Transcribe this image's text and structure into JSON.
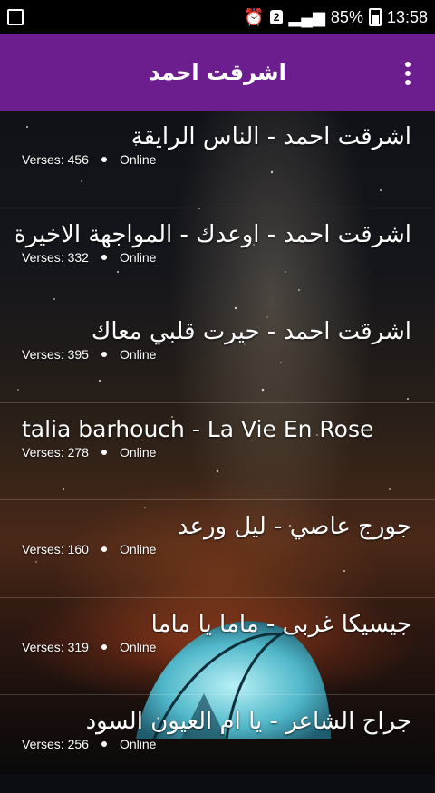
{
  "status_bar": {
    "badge": "2",
    "battery": "85%",
    "time": "13:58"
  },
  "app_bar": {
    "title": "اشرقت احمد"
  },
  "songs": [
    {
      "title": "اشرقت احمد - الناس الرايقة",
      "verses_label": "Verses: 456",
      "status": "Online"
    },
    {
      "title": "اشرقت احمد - اوعدك - المواجهة الاخيرة",
      "verses_label": "Verses: 332",
      "status": "Online"
    },
    {
      "title": "اشرقت احمد - حيرت قلبي معاك",
      "verses_label": "Verses: 395",
      "status": "Online"
    },
    {
      "title": "talia barhouch - La Vie En Rose",
      "verses_label": "Verses: 278",
      "status": "Online"
    },
    {
      "title": "جورج عاصي - ليل ورعد",
      "verses_label": "Verses: 160",
      "status": "Online"
    },
    {
      "title": "جيسيكا غربى - ماما يا ماما",
      "verses_label": "Verses: 319",
      "status": "Online"
    },
    {
      "title": "جراح الشاعر - يا ام العيون السود",
      "verses_label": "Verses: 256",
      "status": "Online"
    }
  ]
}
